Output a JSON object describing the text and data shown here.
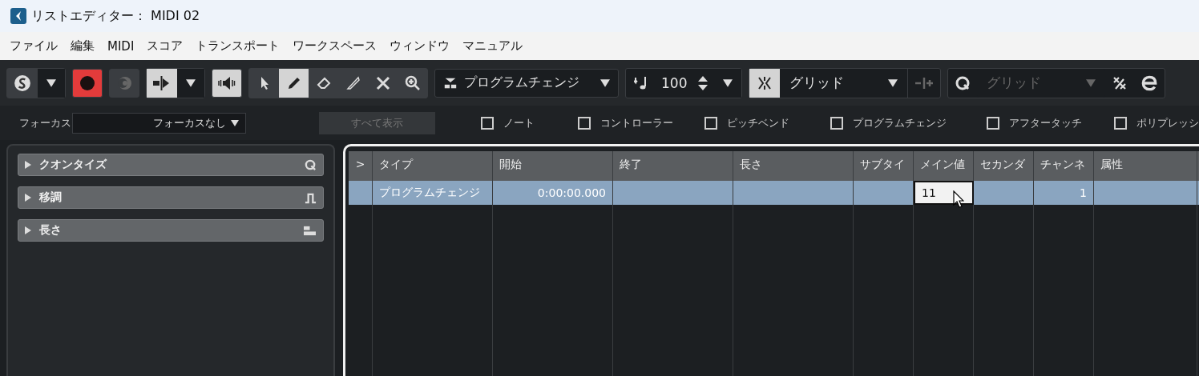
{
  "window": {
    "title": "リストエディター： MIDI 02"
  },
  "menu": [
    "ファイル",
    "編集",
    "MIDI",
    "スコア",
    "トランスポート",
    "ワークスペース",
    "ウィンドウ",
    "マニュアル"
  ],
  "toolbar": {
    "record_active": true,
    "autoscroll_active": true,
    "acoustic_feedback_active": true,
    "tools": [
      {
        "kind": "arrow",
        "selected": false
      },
      {
        "kind": "pencil",
        "selected": true
      },
      {
        "kind": "eraser",
        "selected": false
      },
      {
        "kind": "knife",
        "selected": false
      },
      {
        "kind": "mute",
        "selected": false
      },
      {
        "kind": "zoom",
        "selected": false
      }
    ],
    "event_type": "プログラムチェンジ",
    "velocity": "100",
    "snap_active": true,
    "snap": "グリッド",
    "quantize": {
      "value": "グリッド",
      "disabled": true
    }
  },
  "filter": {
    "focus_label": "フォーカス",
    "focus_value": "フォーカスなし",
    "show_all": {
      "label": "すべて表示",
      "disabled": true
    },
    "checkboxes": [
      {
        "label": "ノート",
        "checked": false
      },
      {
        "label": "コントローラー",
        "checked": false
      },
      {
        "label": "ピッチベンド",
        "checked": false
      },
      {
        "label": "プログラムチェンジ",
        "checked": false
      },
      {
        "label": "アフタータッチ",
        "checked": false
      },
      {
        "label": "ポリプレッシ",
        "checked": false
      }
    ]
  },
  "sections": [
    {
      "label": "クオンタイズ",
      "kind": "quantize",
      "expanded": false
    },
    {
      "label": "移調",
      "kind": "transpose",
      "expanded": false
    },
    {
      "label": "長さ",
      "kind": "length",
      "expanded": false
    }
  ],
  "table": {
    "expander": ">",
    "columns": [
      "タイプ",
      "開始",
      "終了",
      "長さ",
      "サブタイ",
      "メイン値",
      "セカンダ",
      "チャンネ",
      "属性"
    ],
    "rows": [
      {
        "selected": true,
        "cells": [
          {
            "text": "プログラムチェンジ",
            "editing": false
          },
          {
            "text": "0:00:00.000",
            "editing": false
          },
          {
            "editing": false
          },
          {
            "editing": false
          },
          {
            "editing": false
          },
          {
            "text": "11",
            "editing": true
          },
          {
            "editing": false
          },
          {
            "text": "1",
            "editing": false
          },
          {
            "editing": false
          }
        ]
      }
    ]
  }
}
